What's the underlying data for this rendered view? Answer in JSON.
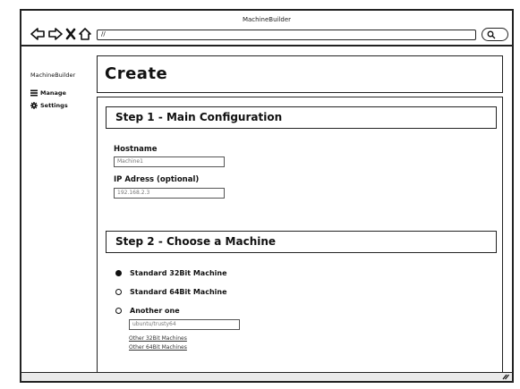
{
  "window": {
    "title": "MachineBuilder",
    "address": "//"
  },
  "sidebar": {
    "brand": "MachineBuilder",
    "items": [
      {
        "label": "Manage",
        "icon": "list-icon"
      },
      {
        "label": "Settings",
        "icon": "gear-icon"
      }
    ]
  },
  "header": {
    "title": "Create"
  },
  "step1": {
    "title": "Step 1 - Main Configuration",
    "hostname_label": "Hostname",
    "hostname_value": "Machine1",
    "ip_label": "IP Adress (optional)",
    "ip_value": "192.168.2.3"
  },
  "step2": {
    "title": "Step 2 - Choose a Machine",
    "options": [
      {
        "label": "Standard 32Bit Machine",
        "selected": true
      },
      {
        "label": "Standard 64Bit Machine",
        "selected": false
      },
      {
        "label": "Another one",
        "selected": false
      }
    ],
    "other_value": "ubuntu/trusty64",
    "links": [
      "Other 32Bit Machines",
      "Other 64Bit Machines"
    ]
  }
}
